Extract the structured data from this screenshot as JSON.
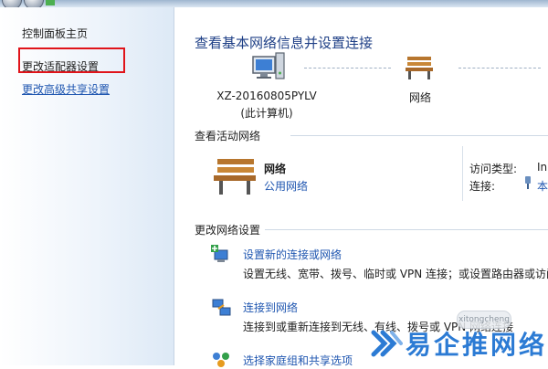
{
  "sidebar": {
    "home": "控制面板主页",
    "adapter": "更改适配器设置",
    "advanced": "更改高级共享设置"
  },
  "main": {
    "title": "查看基本网络信息并设置连接",
    "map": {
      "computer_name": "XZ-20160805PYLV",
      "computer_sub": "(此计算机)",
      "network_label": "网络"
    },
    "active_section": "查看活动网络",
    "active": {
      "name": "网络",
      "type": "公用网络",
      "access_label": "访问类型:",
      "access_value": "In",
      "conn_label": "连接:",
      "conn_value": "本"
    },
    "change_section": "更改网络设置",
    "tasks": [
      {
        "link": "设置新的连接或网络",
        "desc": "设置无线、宽带、拨号、临时或 VPN 连接；或设置路由器或访问",
        "icon": "new-connection-icon"
      },
      {
        "link": "连接到网络",
        "desc": "连接到或重新连接到无线、有线、拨号或 VPN 网络连接",
        "icon": "connect-network-icon"
      },
      {
        "link": "选择家庭组和共享选项",
        "desc": "",
        "icon": "homegroup-icon"
      }
    ]
  },
  "watermark": {
    "text": "易企推网络",
    "badge": "xitongcheng"
  },
  "colors": {
    "link": "#1f56b0",
    "title": "#1e3f86",
    "highlight_box": "#e0141a",
    "watermark": "#2c7bd4"
  }
}
